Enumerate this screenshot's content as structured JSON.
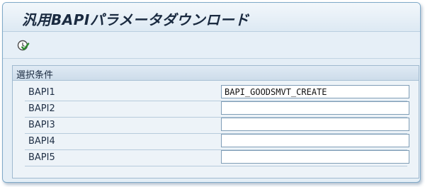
{
  "window": {
    "title": "汎用BAPIパラメータダウンロード"
  },
  "toolbar": {
    "execute_icon": "execute-icon"
  },
  "selection": {
    "title": "選択条件",
    "rows": [
      {
        "label": "BAPI1",
        "value": "BAPI_GOODSMVT_CREATE"
      },
      {
        "label": "BAPI2",
        "value": ""
      },
      {
        "label": "BAPI3",
        "value": ""
      },
      {
        "label": "BAPI4",
        "value": ""
      },
      {
        "label": "BAPI5",
        "value": ""
      }
    ]
  },
  "colors": {
    "frame_background": "#e4eef6",
    "frame_border": "#7fa9c8",
    "execute_icon_green": "#2f8a2f"
  }
}
